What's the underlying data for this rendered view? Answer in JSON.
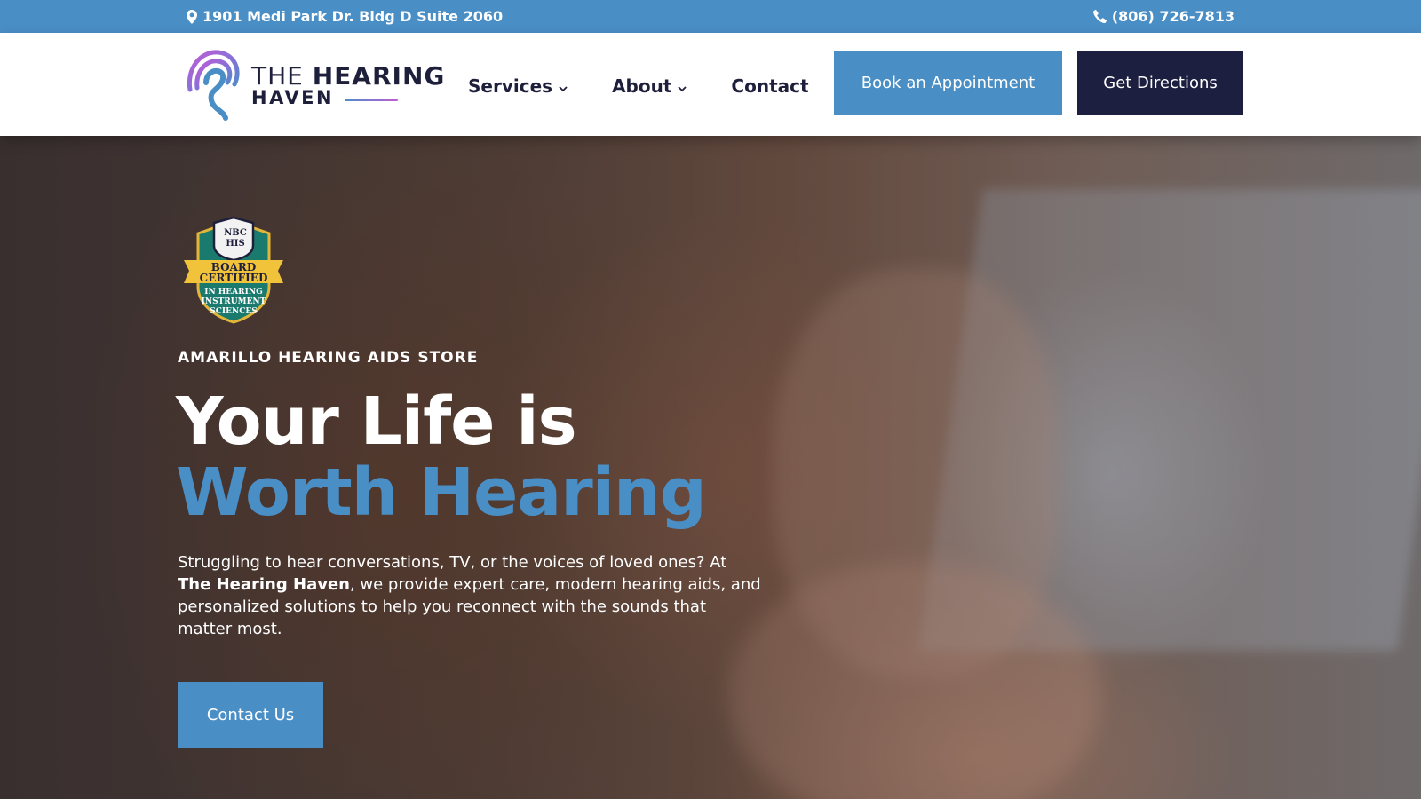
{
  "topbar": {
    "address": "1901 Medi Park Dr. Bldg D Suite 2060",
    "phone": "(806) 726-7813",
    "address_icon": "map-pin-icon",
    "phone_icon": "phone-icon"
  },
  "logo": {
    "line1_light": "THE ",
    "line1_bold": "HEARING",
    "line2": "HAVEN"
  },
  "nav": {
    "services": "Services",
    "about": "About",
    "contact": "Contact"
  },
  "buttons": {
    "book": "Book an Appointment",
    "directions": "Get Directions"
  },
  "badge": {
    "org": "NBC HIS",
    "line1": "BOARD",
    "line2": "CERTIFIED",
    "line3": "IN HEARING",
    "line4": "INSTRUMENT",
    "line5": "SCIENCES"
  },
  "hero": {
    "eyebrow": "AMARILLO HEARING AIDS STORE",
    "headline_1": "Your Life is",
    "headline_2": "Worth Hearing",
    "lead_1": "Struggling to hear conversations, TV, or the voices of loved ones? At ",
    "lead_bold": "The Hearing Haven",
    "lead_2": ", we provide expert care, modern hearing aids, and personalized solutions to help you reconnect with the sounds that matter most.",
    "cta": "Contact Us"
  },
  "colors": {
    "brand_blue": "#4a8ec6",
    "navy": "#1c1f3f",
    "white": "#ffffff"
  }
}
